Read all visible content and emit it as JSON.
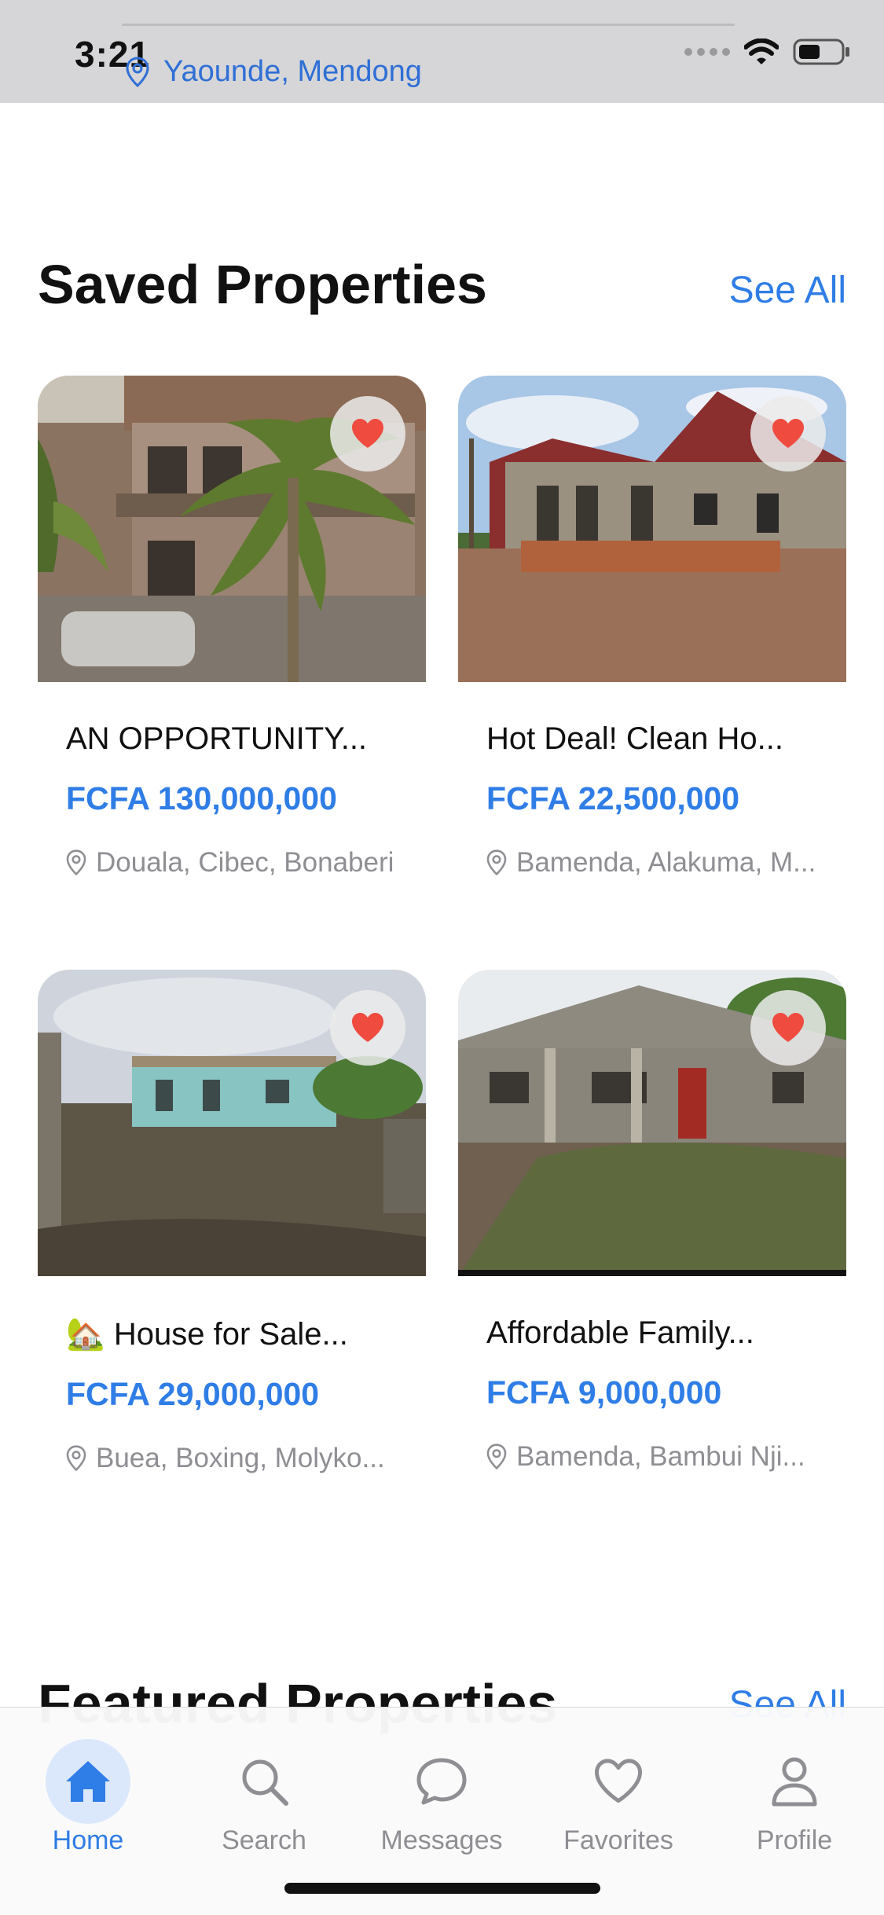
{
  "status": {
    "time": "3:21"
  },
  "header": {
    "location": "Yaounde, Mendong"
  },
  "saved": {
    "title": "Saved Properties",
    "see_all": "See All",
    "cards": [
      {
        "title": "AN OPPORTUNITY...",
        "price": "FCFA 130,000,000",
        "location": "Douala, Cibec, Bonaberi"
      },
      {
        "title": "Hot Deal! Clean Ho...",
        "price": "FCFA 22,500,000",
        "location": "Bamenda, Alakuma, M..."
      },
      {
        "title": "🏡 House for Sale...",
        "price": "FCFA 29,000,000",
        "location": "Buea, Boxing, Molyko..."
      },
      {
        "title": "Affordable Family...",
        "price": "FCFA 9,000,000",
        "location": "Bamenda, Bambui Nji..."
      }
    ]
  },
  "featured": {
    "title": "Featured Properties",
    "see_all": "See All"
  },
  "tabs": [
    {
      "label": "Home",
      "icon": "house-icon",
      "active": true
    },
    {
      "label": "Search",
      "icon": "search-icon",
      "active": false
    },
    {
      "label": "Messages",
      "icon": "message-bubble-icon",
      "active": false
    },
    {
      "label": "Favorites",
      "icon": "heart-icon",
      "active": false
    },
    {
      "label": "Profile",
      "icon": "person-icon",
      "active": false
    }
  ],
  "colors": {
    "accent": "#2f7de6",
    "heart": "#ef4b3f",
    "muted": "#8e8e93"
  }
}
